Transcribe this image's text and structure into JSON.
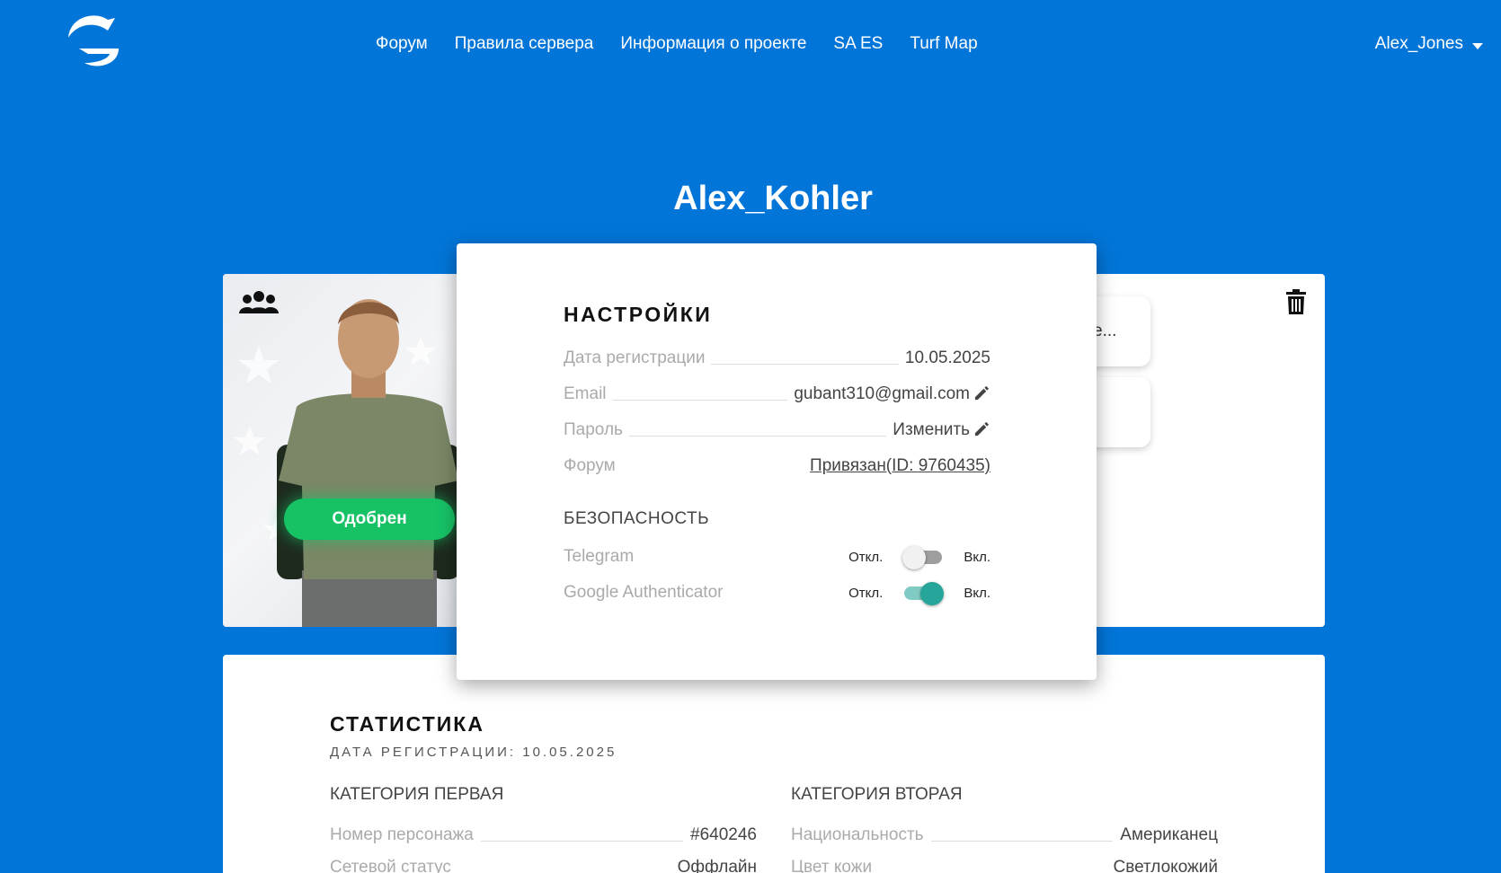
{
  "nav": {
    "links": [
      "Форум",
      "Правила сервера",
      "Информация о проекте",
      "SA ES",
      "Turf Map"
    ],
    "user": "Alex_Jones"
  },
  "page_title": "Alex_Kohler",
  "profile": {
    "status": "Одобрен",
    "mini_card_text": "e..."
  },
  "settings": {
    "title": "НАСТРОЙКИ",
    "registration_label": "Дата регистрации",
    "registration_value": "10.05.2025",
    "email_label": "Email",
    "email_value": "gubant310@gmail.com",
    "password_label": "Пароль",
    "password_action": "Изменить",
    "forum_label": "Форум",
    "forum_value": "Привязан(ID: 9760435)",
    "security_title": "БЕЗОПАСНОСТЬ",
    "off_label": "Откл.",
    "on_label": "Вкл.",
    "telegram_label": "Telegram",
    "telegram_enabled": false,
    "google_label": "Google Authenticator",
    "google_enabled": true
  },
  "stats": {
    "title": "СТАТИСТИКА",
    "subtitle": "ДАТА РЕГИСТРАЦИИ: 10.05.2025",
    "category_one": "КАТЕГОРИЯ ПЕРВАЯ",
    "category_two": "КАТЕГОРИЯ ВТОРАЯ",
    "left_rows": [
      {
        "label": "Номер персонажа",
        "value": "#640246"
      },
      {
        "label": "Сетевой статус",
        "value": "Оффлайн"
      }
    ],
    "right_rows": [
      {
        "label": "Национальность",
        "value": "Американец"
      },
      {
        "label": "Цвет кожи",
        "value": "Светлокожий"
      }
    ]
  },
  "colors": {
    "background": "#0275d8",
    "approved": "#17c265",
    "toggle_on": "#26a69a"
  }
}
